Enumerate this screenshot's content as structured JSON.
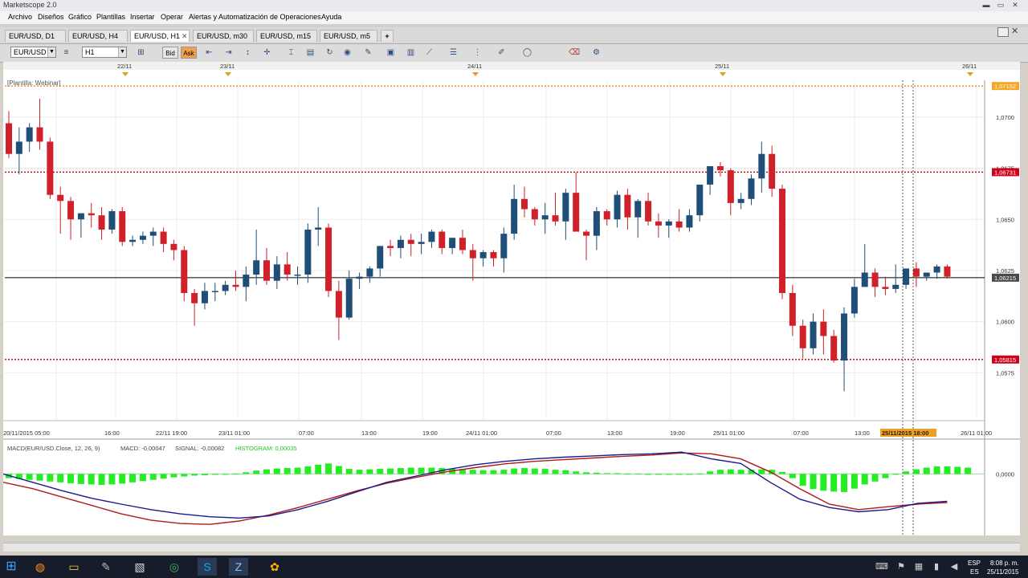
{
  "window": {
    "title": "Marketscope 2.0",
    "min_glyph": "▬",
    "max_glyph": "▭",
    "close_glyph": "✕"
  },
  "menu": [
    "Archivo",
    "Diseños",
    "Gráfico",
    "Plantillas",
    "Insertar",
    "Operar",
    "Alertas y Automatización de Operaciones",
    "Ayuda"
  ],
  "tabs": [
    {
      "label": "EUR/USD, D1",
      "active": false
    },
    {
      "label": "EUR/USD, H4",
      "active": false
    },
    {
      "label": "EUR/USD, H1",
      "active": true
    },
    {
      "label": "EUR/USD, m30",
      "active": false
    },
    {
      "label": "EUR/USD, m15",
      "active": false
    },
    {
      "label": "EUR/USD, m5",
      "active": false
    }
  ],
  "tab_close_glyph": "✕",
  "tab_add_glyph": "+",
  "toolbar": {
    "symbol": "EUR/USD",
    "timeframe": "H1",
    "bid_label": "Bid",
    "ask_label": "Ask",
    "dropdown_glyph": "▼"
  },
  "chart": {
    "template_label": "[Plantilla: Webinar]",
    "top_dates": [
      "22/11",
      "23/11",
      "24/11",
      "25/11",
      "26/11"
    ],
    "time_labels": [
      "20/11/2015 05:00",
      "16:00",
      "22/11 19:00",
      "23/11 01:00",
      "07:00",
      "13:00",
      "19:00",
      "24/11 01:00",
      "07:00",
      "13:00",
      "19:00",
      "25/11 01:00",
      "07:00",
      "13:00",
      "26/11 01:00"
    ],
    "cursor_time_label": "25/11/2015 18:00",
    "price_labels": [
      "1,0700",
      "1,0675",
      "1,0650",
      "1,0625",
      "1,0600",
      "1,0575"
    ],
    "price_markers": [
      {
        "value": "1,07152",
        "price": 1.07152,
        "color": "#f5a623"
      },
      {
        "value": "1,06731",
        "price": 1.06731,
        "color": "#d0021b"
      },
      {
        "value": "1,06215",
        "price": 1.06215,
        "color": "#4a4a4a"
      },
      {
        "value": "1,05815",
        "price": 1.05815,
        "color": "#d0021b"
      }
    ],
    "horizontal_lines": [
      {
        "price": 1.07152,
        "color": "#e07b00",
        "style": "dotted"
      },
      {
        "price": 1.06731,
        "color": "#b00000",
        "style": "dotted"
      },
      {
        "price": 1.06215,
        "color": "#000000",
        "style": "solid"
      },
      {
        "price": 1.05815,
        "color": "#b00000",
        "style": "dotted"
      }
    ],
    "bull_color": "#1f4e79",
    "bear_color": "#d0202a"
  },
  "macd": {
    "label": "MACD(EUR/USD.Close, 12, 26, 9)",
    "macd_text": "MACD: -0,00047",
    "signal_text": "SIGNAL: -0,00082",
    "histogram_text": "HISTOGRAM: 0,00035",
    "zero_label": "0,0000",
    "hist_color": "#22ee22",
    "macd_color": "#1a1a8c",
    "signal_color": "#b01a1a"
  },
  "chart_data": {
    "type": "candlestick",
    "symbol": "EUR/USD",
    "timeframe": "H1",
    "ylim": [
      1.0552,
      1.0718
    ],
    "candles": [
      [
        1.0697,
        1.0703,
        1.068,
        1.0682
      ],
      [
        1.0682,
        1.0695,
        1.0672,
        1.0688
      ],
      [
        1.0688,
        1.0697,
        1.0683,
        1.0695
      ],
      [
        1.0695,
        1.0709,
        1.0684,
        1.0688
      ],
      [
        1.0688,
        1.069,
        1.066,
        1.0662
      ],
      [
        1.0662,
        1.0666,
        1.0643,
        1.0659
      ],
      [
        1.0659,
        1.0661,
        1.064,
        1.065
      ],
      [
        1.065,
        1.0653,
        1.0641,
        1.0653
      ],
      [
        1.0653,
        1.0658,
        1.0646,
        1.0652
      ],
      [
        1.0652,
        1.0656,
        1.064,
        1.0645
      ],
      [
        1.0645,
        1.0655,
        1.0643,
        1.0654
      ],
      [
        1.0654,
        1.0656,
        1.0637,
        1.0639
      ],
      [
        1.0639,
        1.0642,
        1.0637,
        1.064
      ],
      [
        1.064,
        1.0644,
        1.0638,
        1.0642
      ],
      [
        1.0642,
        1.0646,
        1.0637,
        1.0644
      ],
      [
        1.0644,
        1.0646,
        1.0634,
        1.0638
      ],
      [
        1.0638,
        1.064,
        1.063,
        1.0635
      ],
      [
        1.0635,
        1.0637,
        1.061,
        1.0614
      ],
      [
        1.0614,
        1.0616,
        1.0598,
        1.0609
      ],
      [
        1.0609,
        1.0619,
        1.0606,
        1.0615
      ],
      [
        1.0615,
        1.0619,
        1.061,
        1.0615
      ],
      [
        1.0615,
        1.062,
        1.0613,
        1.0618
      ],
      [
        1.0618,
        1.0625,
        1.0615,
        1.0617
      ],
      [
        1.0617,
        1.0627,
        1.061,
        1.0623
      ],
      [
        1.0623,
        1.0645,
        1.0618,
        1.063
      ],
      [
        1.063,
        1.0636,
        1.0618,
        1.062
      ],
      [
        1.062,
        1.0632,
        1.0616,
        1.0628
      ],
      [
        1.0628,
        1.0634,
        1.062,
        1.0623
      ],
      [
        1.0623,
        1.0627,
        1.0618,
        1.0623
      ],
      [
        1.0623,
        1.0648,
        1.0619,
        1.0645
      ],
      [
        1.0645,
        1.0656,
        1.0637,
        1.0646
      ],
      [
        1.0646,
        1.0648,
        1.0612,
        1.0615
      ],
      [
        1.0615,
        1.062,
        1.0591,
        1.0602
      ],
      [
        1.0602,
        1.0625,
        1.0601,
        1.0621
      ],
      [
        1.0621,
        1.0624,
        1.0616,
        1.0622
      ],
      [
        1.0622,
        1.0627,
        1.0619,
        1.0626
      ],
      [
        1.0626,
        1.0637,
        1.0622,
        1.0637
      ],
      [
        1.0637,
        1.064,
        1.0632,
        1.0636
      ],
      [
        1.0636,
        1.0642,
        1.0631,
        1.064
      ],
      [
        1.064,
        1.0643,
        1.0632,
        1.0638
      ],
      [
        1.0638,
        1.0643,
        1.0633,
        1.0639
      ],
      [
        1.0639,
        1.0645,
        1.0636,
        1.0644
      ],
      [
        1.0644,
        1.0645,
        1.0633,
        1.0636
      ],
      [
        1.0636,
        1.0641,
        1.0633,
        1.0641
      ],
      [
        1.0641,
        1.0645,
        1.0633,
        1.0635
      ],
      [
        1.0635,
        1.0638,
        1.062,
        1.0631
      ],
      [
        1.0631,
        1.0635,
        1.0627,
        1.0634
      ],
      [
        1.0634,
        1.0635,
        1.0627,
        1.0631
      ],
      [
        1.0631,
        1.0646,
        1.0624,
        1.0643
      ],
      [
        1.0643,
        1.0667,
        1.064,
        1.066
      ],
      [
        1.066,
        1.0666,
        1.0651,
        1.0655
      ],
      [
        1.0655,
        1.0656,
        1.0647,
        1.065
      ],
      [
        1.065,
        1.0658,
        1.0643,
        1.0652
      ],
      [
        1.0652,
        1.0663,
        1.0647,
        1.0649
      ],
      [
        1.0649,
        1.0665,
        1.064,
        1.0663
      ],
      [
        1.0663,
        1.0673,
        1.0655,
        1.0644
      ],
      [
        1.0644,
        1.0645,
        1.063,
        1.0642
      ],
      [
        1.0642,
        1.0656,
        1.0635,
        1.0654
      ],
      [
        1.0654,
        1.0655,
        1.0647,
        1.065
      ],
      [
        1.065,
        1.0664,
        1.0646,
        1.0662
      ],
      [
        1.0662,
        1.0665,
        1.0645,
        1.0651
      ],
      [
        1.0651,
        1.066,
        1.0641,
        1.0659
      ],
      [
        1.0659,
        1.0663,
        1.0647,
        1.0649
      ],
      [
        1.0649,
        1.0653,
        1.0641,
        1.0647
      ],
      [
        1.0647,
        1.065,
        1.0641,
        1.0649
      ],
      [
        1.0649,
        1.0655,
        1.0644,
        1.0646
      ],
      [
        1.0646,
        1.0655,
        1.0644,
        1.0652
      ],
      [
        1.0652,
        1.0663,
        1.0649,
        1.0667
      ],
      [
        1.0667,
        1.0676,
        1.0662,
        1.0676
      ],
      [
        1.0676,
        1.0678,
        1.0671,
        1.0674
      ],
      [
        1.0674,
        1.0675,
        1.0652,
        1.0658
      ],
      [
        1.0658,
        1.0663,
        1.0655,
        1.066
      ],
      [
        1.066,
        1.0672,
        1.0657,
        1.067
      ],
      [
        1.067,
        1.0688,
        1.0663,
        1.0682
      ],
      [
        1.0682,
        1.0686,
        1.0661,
        1.0665
      ],
      [
        1.0665,
        1.0667,
        1.0611,
        1.0614
      ],
      [
        1.0614,
        1.0618,
        1.0593,
        1.0598
      ],
      [
        1.0598,
        1.0601,
        1.0582,
        1.0587
      ],
      [
        1.0587,
        1.0604,
        1.0584,
        1.06
      ],
      [
        1.06,
        1.0606,
        1.0584,
        1.0593
      ],
      [
        1.0593,
        1.0596,
        1.058,
        1.0581
      ],
      [
        1.0581,
        1.0607,
        1.0566,
        1.0604
      ],
      [
        1.0604,
        1.0621,
        1.0602,
        1.0617
      ],
      [
        1.0617,
        1.0638,
        1.0617,
        1.0624
      ],
      [
        1.0624,
        1.0626,
        1.0612,
        1.0617
      ],
      [
        1.0617,
        1.0622,
        1.0613,
        1.0616
      ],
      [
        1.0616,
        1.0628,
        1.0614,
        1.0618
      ],
      [
        1.0618,
        1.0626,
        1.0616,
        1.0626
      ],
      [
        1.0626,
        1.0629,
        1.0617,
        1.0622
      ],
      [
        1.0622,
        1.0624,
        1.062,
        1.0624
      ],
      [
        1.0624,
        1.0628,
        1.0621,
        1.0627
      ],
      [
        1.0627,
        1.0628,
        1.0621,
        1.0622
      ]
    ],
    "macd_histogram": [
      -0.0001,
      -0.00012,
      -0.00014,
      -0.00016,
      -0.00018,
      -0.0002,
      -0.00022,
      -0.00024,
      -0.00025,
      -0.00026,
      -0.00025,
      -0.00023,
      -0.0002,
      -0.00017,
      -0.00014,
      -0.00011,
      -8e-05,
      -6e-05,
      -4e-05,
      -3e-05,
      -2e-05,
      -1e-05,
      1e-05,
      4e-05,
      8e-05,
      0.00011,
      0.00013,
      0.00014,
      0.00015,
      0.00018,
      0.00022,
      0.00025,
      0.00019,
      0.00012,
      0.0001,
      0.00011,
      0.00012,
      0.00013,
      0.00014,
      0.00015,
      0.00015,
      0.00015,
      0.00014,
      0.00013,
      0.00012,
      0.0001,
      9e-05,
      9e-05,
      0.0001,
      0.00013,
      0.00014,
      0.00013,
      0.00012,
      0.0001,
      9e-05,
      6e-05,
      4e-05,
      3e-05,
      2e-05,
      2e-05,
      1e-05,
      1e-05,
      0.0,
      0.0,
      -1e-05,
      -1e-05,
      -1e-05,
      1e-05,
      6e-05,
      0.0001,
      0.00011,
      0.0001,
      0.0001,
      0.00011,
      0.0001,
      5e-05,
      -0.0001,
      -0.00028,
      -0.00036,
      -0.0004,
      -0.00042,
      -0.00043,
      -0.00035,
      -0.00025,
      -0.00018,
      -0.0001,
      -1e-05,
      6e-05,
      0.00011,
      0.00015,
      0.00018,
      0.00018,
      0.00017,
      0.00015
    ],
    "macd_line_values": [
      0.0,
      -0.0002,
      -0.0004,
      -0.00058,
      -0.00072,
      -0.00085,
      -0.00095,
      -0.00102,
      -0.00105,
      -0.001,
      -0.00085,
      -0.00065,
      -0.00042,
      -0.0002,
      -5e-05,
      0.0001,
      0.00022,
      0.0003,
      0.00036,
      0.0004,
      0.00043,
      0.00046,
      0.00048,
      0.00052,
      0.00036,
      0.00025,
      -0.0002,
      -0.0006,
      -0.0008,
      -0.0009,
      -0.00085,
      -0.0007,
      -0.00065
    ],
    "signal_line_values": [
      -0.0002,
      -0.00035,
      -0.00055,
      -0.00075,
      -0.00095,
      -0.0011,
      -0.00118,
      -0.0012,
      -0.00112,
      -0.00098,
      -0.0008,
      -0.0006,
      -0.0004,
      -0.00022,
      -8e-05,
      5e-05,
      0.00015,
      0.00024,
      0.0003,
      0.00034,
      0.00038,
      0.00042,
      0.00045,
      0.0005,
      0.00048,
      0.00036,
      5e-05,
      -0.00035,
      -0.00072,
      -0.00085,
      -0.00078,
      -0.00072,
      -0.00068
    ],
    "macd_ylim": [
      -0.00135,
      0.0006
    ]
  },
  "taskbar": {
    "lang_code": "ESP",
    "lang_region": "ES",
    "time": "8:08 p. m.",
    "date": "25/11/2015"
  }
}
